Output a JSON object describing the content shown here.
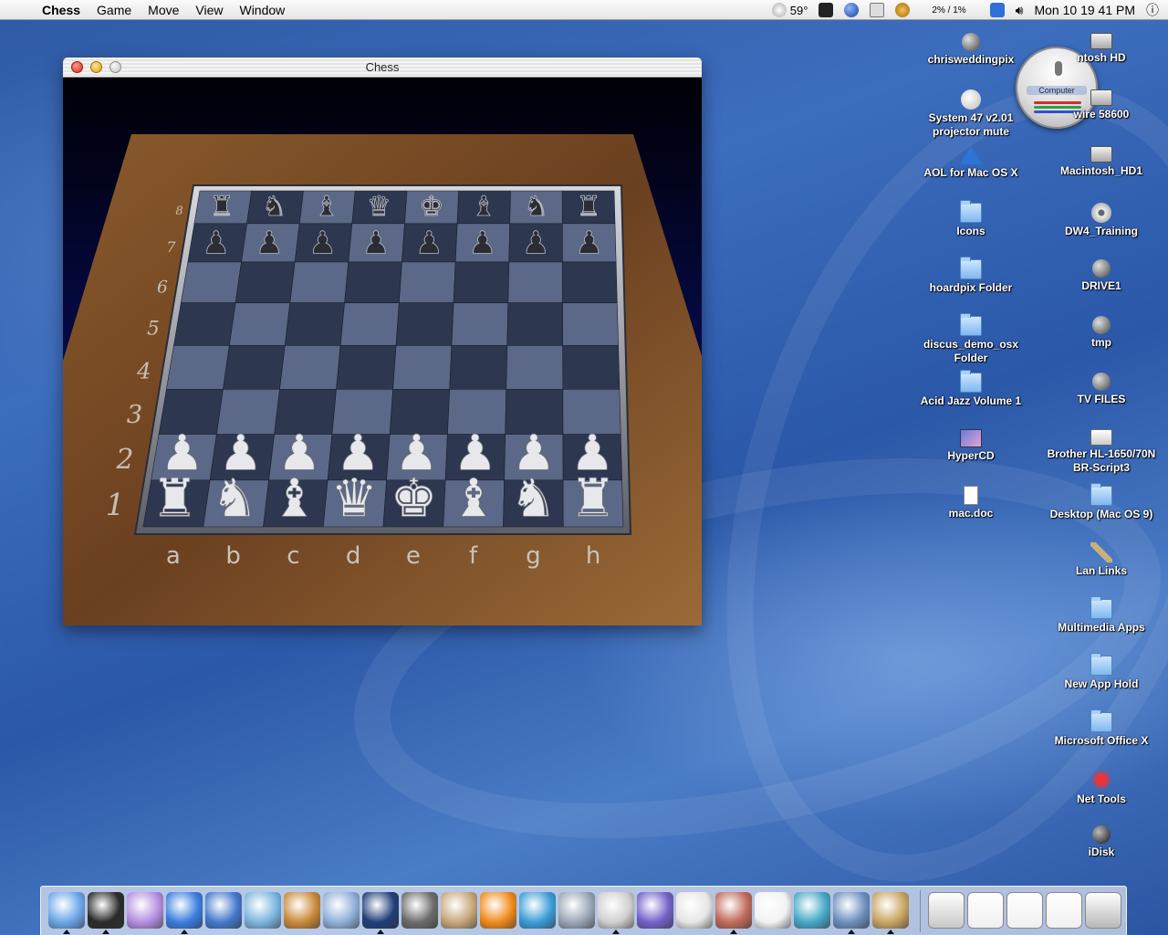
{
  "menubar": {
    "app_name": "Chess",
    "menus": [
      "Game",
      "Move",
      "View",
      "Window"
    ],
    "status": {
      "temperature": "59°",
      "cpu": "2% / 1%",
      "clock": "Mon 10 19 41 PM"
    }
  },
  "window": {
    "title": "Chess",
    "board": {
      "files": [
        "a",
        "b",
        "c",
        "d",
        "e",
        "f",
        "g",
        "h"
      ],
      "ranks": [
        "1",
        "2",
        "3",
        "4",
        "5",
        "6",
        "7",
        "8"
      ],
      "black_back_rank": [
        "♜",
        "♞",
        "♝",
        "♛",
        "♚",
        "♝",
        "♞",
        "♜"
      ],
      "white_back_rank": [
        "♜",
        "♞",
        "♝",
        "♛",
        "♚",
        "♝",
        "♞",
        "♜"
      ],
      "pawn": "♟"
    }
  },
  "widget": {
    "label": "Computer"
  },
  "desktop_icons_left": [
    {
      "label": "chrisweddingpix",
      "icon": "globe"
    },
    {
      "label": "System 47 v2.01 projector mute",
      "icon": "flash"
    },
    {
      "label": "AOL for Mac OS X",
      "icon": "aol"
    },
    {
      "label": "Icons",
      "icon": "folder"
    },
    {
      "label": "hoardpix Folder",
      "icon": "folder"
    },
    {
      "label": "discus_demo_osx Folder",
      "icon": "folder"
    },
    {
      "label": "Acid Jazz Volume 1",
      "icon": "folder"
    },
    {
      "label": "HyperCD",
      "icon": "hyper"
    },
    {
      "label": "mac.doc",
      "icon": "doc"
    }
  ],
  "desktop_icons_right": [
    {
      "label": "ntosh HD",
      "icon": "disk"
    },
    {
      "label": "wire 58600",
      "icon": "disk"
    },
    {
      "label": "Macintosh_HD1",
      "icon": "disk"
    },
    {
      "label": "DW4_Training",
      "icon": "cd"
    },
    {
      "label": "DRIVE1",
      "icon": "globe"
    },
    {
      "label": "tmp",
      "icon": "globe"
    },
    {
      "label": "TV FILES",
      "icon": "globe"
    },
    {
      "label": "Brother HL-1650/70N BR-Script3",
      "icon": "printer"
    },
    {
      "label": "Desktop (Mac OS 9)",
      "icon": "folder"
    },
    {
      "label": "Lan Links",
      "icon": "satellite"
    },
    {
      "label": "Multimedia Apps",
      "icon": "folder"
    },
    {
      "label": "New App Hold",
      "icon": "folder"
    },
    {
      "label": "Microsoft Office X",
      "icon": "folder"
    },
    {
      "label": "Net Tools",
      "icon": "red"
    },
    {
      "label": "iDisk",
      "icon": "ball"
    }
  ],
  "dock": {
    "apps": [
      {
        "name": "finder",
        "color": "#6aa6e8",
        "running": true
      },
      {
        "name": "blackbox",
        "color": "#2a2a2a",
        "running": true
      },
      {
        "name": "mail-app",
        "color": "#b58ee0",
        "running": false
      },
      {
        "name": "internet-explorer",
        "color": "#3a7de0",
        "running": true
      },
      {
        "name": "imovie",
        "color": "#4477cc",
        "running": false
      },
      {
        "name": "iphoto",
        "color": "#7bb6e0",
        "running": false
      },
      {
        "name": "photo-app",
        "color": "#c98a3a",
        "running": false
      },
      {
        "name": "itunes",
        "color": "#8fb0d8",
        "running": false
      },
      {
        "name": "network-app",
        "color": "#1f3e78",
        "running": true
      },
      {
        "name": "sherlock",
        "color": "#6b6b6b",
        "running": false
      },
      {
        "name": "dictionary",
        "color": "#c7a77a",
        "running": false
      },
      {
        "name": "fish-app",
        "color": "#f08a1a",
        "running": false
      },
      {
        "name": "quicktime",
        "color": "#3b9cd8",
        "running": false
      },
      {
        "name": "system-prefs",
        "color": "#9aa6b6",
        "running": false
      },
      {
        "name": "apple-app",
        "color": "#cfcfcf",
        "running": true
      },
      {
        "name": "graphing-app",
        "color": "#7560c8",
        "running": false
      },
      {
        "name": "text-edit",
        "color": "#e6e6e6",
        "running": false
      },
      {
        "name": "calendar-app",
        "color": "#c06a5a",
        "running": true
      },
      {
        "name": "google",
        "color": "#f2f2f2",
        "running": false
      },
      {
        "name": "ftp-app",
        "color": "#47a7c7",
        "running": false
      },
      {
        "name": "preview",
        "color": "#6c8fbf",
        "running": true
      },
      {
        "name": "chess",
        "color": "#c9a561",
        "running": true
      }
    ],
    "extras": [
      {
        "name": "mail-at",
        "color": "#c8c8c8"
      },
      {
        "name": "window-thumb-1",
        "color": "#f0f0f0"
      },
      {
        "name": "window-thumb-2",
        "color": "#f0f0f0"
      },
      {
        "name": "window-thumb-3",
        "color": "#f0f0f0"
      },
      {
        "name": "trash",
        "color": "#b8b8b8"
      }
    ]
  }
}
